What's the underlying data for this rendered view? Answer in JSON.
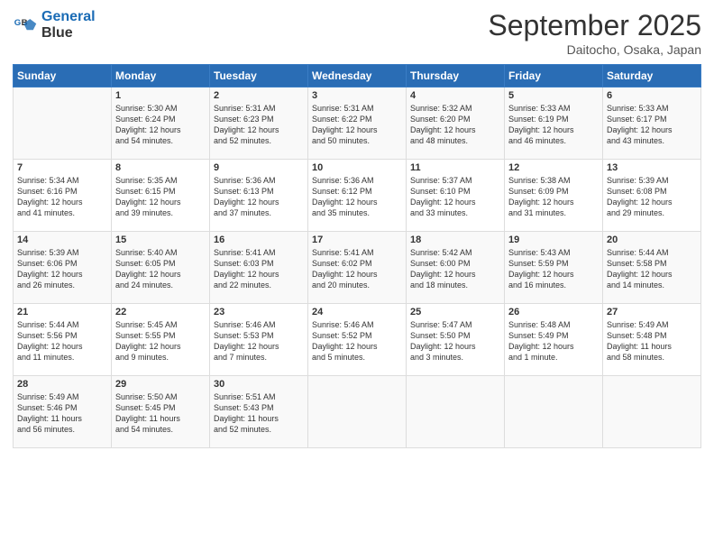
{
  "logo": {
    "line1": "General",
    "line2": "Blue"
  },
  "title": "September 2025",
  "location": "Daitocho, Osaka, Japan",
  "weekdays": [
    "Sunday",
    "Monday",
    "Tuesday",
    "Wednesday",
    "Thursday",
    "Friday",
    "Saturday"
  ],
  "weeks": [
    [
      {
        "day": "",
        "info": ""
      },
      {
        "day": "1",
        "info": "Sunrise: 5:30 AM\nSunset: 6:24 PM\nDaylight: 12 hours\nand 54 minutes."
      },
      {
        "day": "2",
        "info": "Sunrise: 5:31 AM\nSunset: 6:23 PM\nDaylight: 12 hours\nand 52 minutes."
      },
      {
        "day": "3",
        "info": "Sunrise: 5:31 AM\nSunset: 6:22 PM\nDaylight: 12 hours\nand 50 minutes."
      },
      {
        "day": "4",
        "info": "Sunrise: 5:32 AM\nSunset: 6:20 PM\nDaylight: 12 hours\nand 48 minutes."
      },
      {
        "day": "5",
        "info": "Sunrise: 5:33 AM\nSunset: 6:19 PM\nDaylight: 12 hours\nand 46 minutes."
      },
      {
        "day": "6",
        "info": "Sunrise: 5:33 AM\nSunset: 6:17 PM\nDaylight: 12 hours\nand 43 minutes."
      }
    ],
    [
      {
        "day": "7",
        "info": "Sunrise: 5:34 AM\nSunset: 6:16 PM\nDaylight: 12 hours\nand 41 minutes."
      },
      {
        "day": "8",
        "info": "Sunrise: 5:35 AM\nSunset: 6:15 PM\nDaylight: 12 hours\nand 39 minutes."
      },
      {
        "day": "9",
        "info": "Sunrise: 5:36 AM\nSunset: 6:13 PM\nDaylight: 12 hours\nand 37 minutes."
      },
      {
        "day": "10",
        "info": "Sunrise: 5:36 AM\nSunset: 6:12 PM\nDaylight: 12 hours\nand 35 minutes."
      },
      {
        "day": "11",
        "info": "Sunrise: 5:37 AM\nSunset: 6:10 PM\nDaylight: 12 hours\nand 33 minutes."
      },
      {
        "day": "12",
        "info": "Sunrise: 5:38 AM\nSunset: 6:09 PM\nDaylight: 12 hours\nand 31 minutes."
      },
      {
        "day": "13",
        "info": "Sunrise: 5:39 AM\nSunset: 6:08 PM\nDaylight: 12 hours\nand 29 minutes."
      }
    ],
    [
      {
        "day": "14",
        "info": "Sunrise: 5:39 AM\nSunset: 6:06 PM\nDaylight: 12 hours\nand 26 minutes."
      },
      {
        "day": "15",
        "info": "Sunrise: 5:40 AM\nSunset: 6:05 PM\nDaylight: 12 hours\nand 24 minutes."
      },
      {
        "day": "16",
        "info": "Sunrise: 5:41 AM\nSunset: 6:03 PM\nDaylight: 12 hours\nand 22 minutes."
      },
      {
        "day": "17",
        "info": "Sunrise: 5:41 AM\nSunset: 6:02 PM\nDaylight: 12 hours\nand 20 minutes."
      },
      {
        "day": "18",
        "info": "Sunrise: 5:42 AM\nSunset: 6:00 PM\nDaylight: 12 hours\nand 18 minutes."
      },
      {
        "day": "19",
        "info": "Sunrise: 5:43 AM\nSunset: 5:59 PM\nDaylight: 12 hours\nand 16 minutes."
      },
      {
        "day": "20",
        "info": "Sunrise: 5:44 AM\nSunset: 5:58 PM\nDaylight: 12 hours\nand 14 minutes."
      }
    ],
    [
      {
        "day": "21",
        "info": "Sunrise: 5:44 AM\nSunset: 5:56 PM\nDaylight: 12 hours\nand 11 minutes."
      },
      {
        "day": "22",
        "info": "Sunrise: 5:45 AM\nSunset: 5:55 PM\nDaylight: 12 hours\nand 9 minutes."
      },
      {
        "day": "23",
        "info": "Sunrise: 5:46 AM\nSunset: 5:53 PM\nDaylight: 12 hours\nand 7 minutes."
      },
      {
        "day": "24",
        "info": "Sunrise: 5:46 AM\nSunset: 5:52 PM\nDaylight: 12 hours\nand 5 minutes."
      },
      {
        "day": "25",
        "info": "Sunrise: 5:47 AM\nSunset: 5:50 PM\nDaylight: 12 hours\nand 3 minutes."
      },
      {
        "day": "26",
        "info": "Sunrise: 5:48 AM\nSunset: 5:49 PM\nDaylight: 12 hours\nand 1 minute."
      },
      {
        "day": "27",
        "info": "Sunrise: 5:49 AM\nSunset: 5:48 PM\nDaylight: 11 hours\nand 58 minutes."
      }
    ],
    [
      {
        "day": "28",
        "info": "Sunrise: 5:49 AM\nSunset: 5:46 PM\nDaylight: 11 hours\nand 56 minutes."
      },
      {
        "day": "29",
        "info": "Sunrise: 5:50 AM\nSunset: 5:45 PM\nDaylight: 11 hours\nand 54 minutes."
      },
      {
        "day": "30",
        "info": "Sunrise: 5:51 AM\nSunset: 5:43 PM\nDaylight: 11 hours\nand 52 minutes."
      },
      {
        "day": "",
        "info": ""
      },
      {
        "day": "",
        "info": ""
      },
      {
        "day": "",
        "info": ""
      },
      {
        "day": "",
        "info": ""
      }
    ]
  ]
}
